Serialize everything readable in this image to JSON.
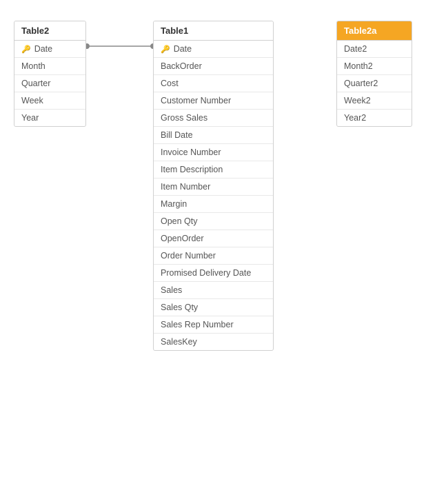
{
  "table2": {
    "title": "Table2",
    "header_style": "white",
    "fields": [
      {
        "name": "Date",
        "key": true
      },
      {
        "name": "Month",
        "key": false
      },
      {
        "name": "Quarter",
        "key": false
      },
      {
        "name": "Week",
        "key": false
      },
      {
        "name": "Year",
        "key": false
      }
    ]
  },
  "table1": {
    "title": "Table1",
    "header_style": "white",
    "fields": [
      {
        "name": "Date",
        "key": true
      },
      {
        "name": "BackOrder",
        "key": false
      },
      {
        "name": "Cost",
        "key": false
      },
      {
        "name": "Customer Number",
        "key": false
      },
      {
        "name": "Gross Sales",
        "key": false
      },
      {
        "name": "Bill Date",
        "key": false
      },
      {
        "name": "Invoice Number",
        "key": false
      },
      {
        "name": "Item Description",
        "key": false
      },
      {
        "name": "Item Number",
        "key": false
      },
      {
        "name": "Margin",
        "key": false
      },
      {
        "name": "Open Qty",
        "key": false
      },
      {
        "name": "OpenOrder",
        "key": false
      },
      {
        "name": "Order Number",
        "key": false
      },
      {
        "name": "Promised Delivery Date",
        "key": false
      },
      {
        "name": "Sales",
        "key": false
      },
      {
        "name": "Sales Qty",
        "key": false
      },
      {
        "name": "Sales Rep Number",
        "key": false
      },
      {
        "name": "SalesKey",
        "key": false
      }
    ]
  },
  "table2a": {
    "title": "Table2a",
    "header_style": "orange",
    "fields": [
      {
        "name": "Date2",
        "key": false
      },
      {
        "name": "Month2",
        "key": false
      },
      {
        "name": "Quarter2",
        "key": false
      },
      {
        "name": "Week2",
        "key": false
      },
      {
        "name": "Year2",
        "key": false
      }
    ]
  },
  "connector": {
    "from_table": "table2",
    "from_field": "Date",
    "to_table": "table1",
    "to_field": "Date"
  }
}
